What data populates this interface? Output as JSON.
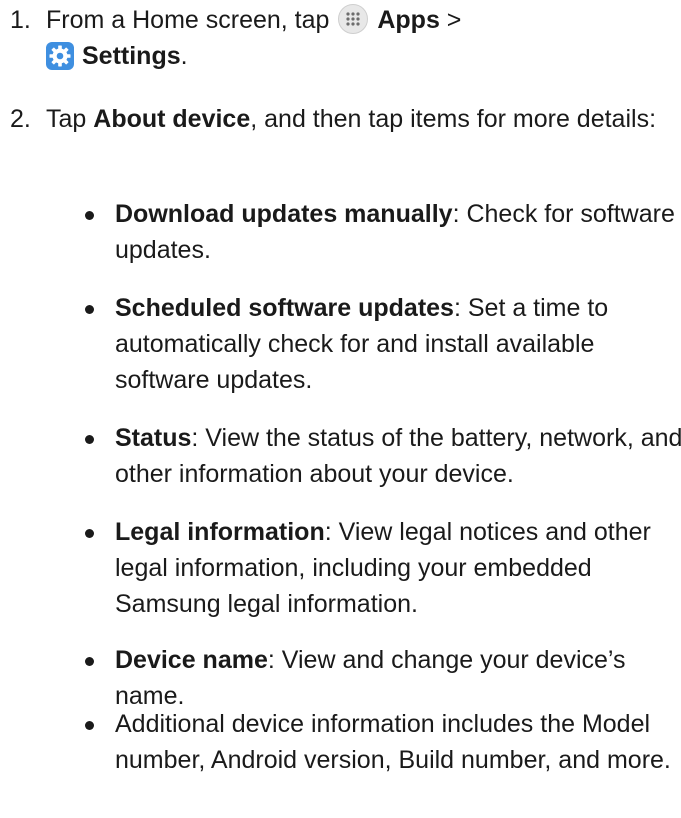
{
  "steps": [
    {
      "number": "1.",
      "parts": {
        "pre": "From a Home screen, tap ",
        "apps_label": "Apps",
        "sep": " >",
        "settings_label": "Settings",
        "end": "."
      }
    },
    {
      "number": "2.",
      "parts": {
        "pre": "Tap ",
        "bold": "About device",
        "post": ", and then tap items for more details:"
      }
    }
  ],
  "bullets": [
    {
      "bold": "Download updates manually",
      "text": ": Check for software updates."
    },
    {
      "bold": "Scheduled software updates",
      "text": ": Set a time to automatically check for and install available software updates."
    },
    {
      "bold": "Status",
      "text": ": View the status of the battery, network, and other information about your device."
    },
    {
      "bold": "Legal information",
      "text": ": View legal notices and other legal information, including your embedded Samsung legal information."
    },
    {
      "bold": "Device name",
      "text": ": View and change your device’s name."
    },
    {
      "bold": "",
      "text": "Additional device information includes the Model number, Android version, Build number, and more."
    }
  ],
  "icons": {
    "apps": "apps-grid-icon",
    "settings": "settings-gear-icon"
  },
  "colors": {
    "settings_icon_bg": "#3f8fe0",
    "text": "#1a1a1a"
  }
}
